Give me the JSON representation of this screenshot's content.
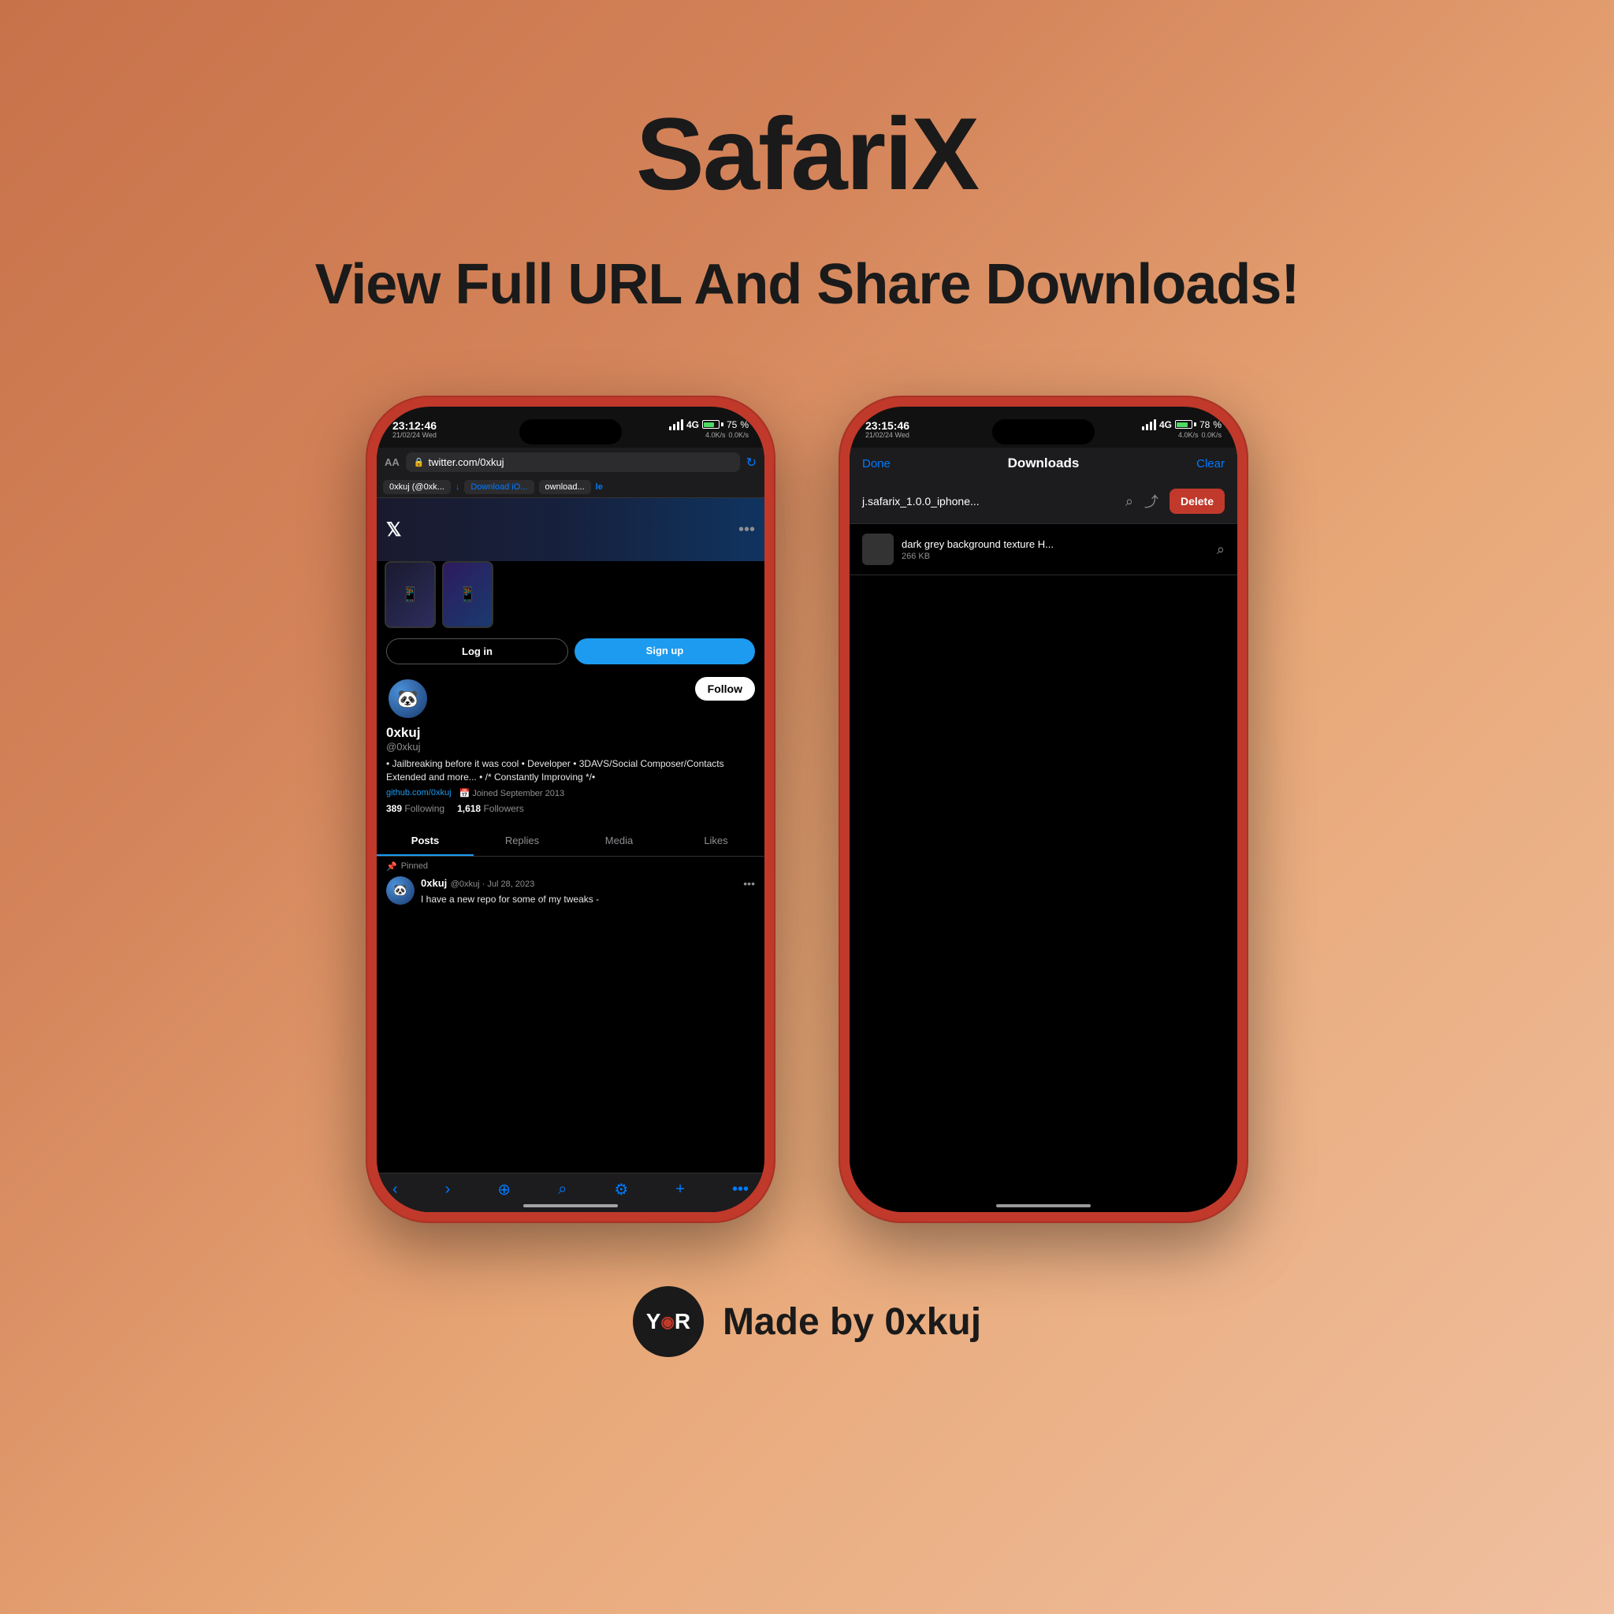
{
  "page": {
    "title": "SafariX",
    "subtitle": "View Full URL And Share Downloads!",
    "background": "linear-gradient(135deg, #c8724a 0%, #d4845a 30%, #e8a878 60%, #f0c0a0 100%)"
  },
  "phone1": {
    "status_time": "23:12:46",
    "status_date": "21/02/24 Wed",
    "status_network": "4G",
    "status_battery": "75",
    "url_text": "twitter.com/0xkuj",
    "tab1": "0xkuj (@0xk...",
    "tab2": "Download iO...",
    "tab3": "ownload...",
    "tab4": "le",
    "twitter_handle_full": "@0xkuj",
    "profile_name": "0xkuj",
    "profile_handle": "@0xkuj",
    "profile_bio": "• Jailbreaking before it was cool • Developer • 3DAVS/Social Composer/Contacts Extended and more... • /* Constantly Improving */•",
    "profile_github": "github.com/0xkuj",
    "profile_joined": "Joined September 2013",
    "following_count": "389",
    "following_label": "Following",
    "followers_count": "1,618",
    "followers_label": "Followers",
    "tab_posts": "Posts",
    "tab_replies": "Replies",
    "tab_media": "Media",
    "tab_likes": "Likes",
    "pinned_label": "Pinned",
    "tweet_name": "0xkuj",
    "tweet_handle": "@0xkuj · Jul 28, 2023",
    "tweet_text": "I have a new repo for some of my tweaks -",
    "follow_btn": "Follow",
    "btn_login": "Log in",
    "btn_signup": "Sign up"
  },
  "phone2": {
    "status_time": "23:15:46",
    "status_date": "21/02/24 Wed",
    "status_network": "4G",
    "status_battery": "78",
    "nav_done": "Done",
    "nav_title": "Downloads",
    "nav_clear": "Clear",
    "file1_name": "j.safarix_1.0.0_iphone...",
    "delete_btn": "Delete",
    "file2_name": "dark grey background texture H...",
    "file2_size": "266 KB"
  },
  "footer": {
    "logo_text": "Y◉R",
    "made_by": "Made by 0xkuj"
  }
}
